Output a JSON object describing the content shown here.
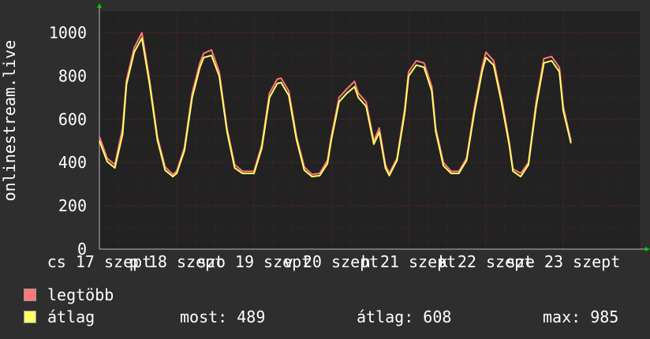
{
  "chart_data": {
    "type": "line",
    "title": "",
    "ylabel": "onlinestream.live",
    "ylim": [
      0,
      1100
    ],
    "yticks": [
      0,
      200,
      400,
      600,
      800,
      1000
    ],
    "xtick_labels": [
      "cs 17 szept",
      "p 18 szept",
      "szo 19 szept",
      "v 20 szept",
      "h 21 szept",
      "k 22 szept",
      "sze 23 szept"
    ],
    "grid": true,
    "colors": {
      "max": "#ff7777",
      "avg": "#ffff66",
      "grid": "#7a2222",
      "axis": "#bbbbbb",
      "arrow": "#00cc00"
    },
    "series": [
      {
        "name": "legtöbb",
        "key": "max",
        "color": "#ff7777"
      },
      {
        "name": "átlag",
        "key": "avg",
        "color": "#ffff66"
      }
    ],
    "x": [
      0,
      0.1,
      0.2,
      0.3,
      0.35,
      0.45,
      0.55,
      0.65,
      0.75,
      0.85,
      0.95,
      1.0,
      1.1,
      1.2,
      1.3,
      1.35,
      1.45,
      1.55,
      1.65,
      1.75,
      1.85,
      1.95,
      2.0,
      2.1,
      2.2,
      2.3,
      2.35,
      2.45,
      2.55,
      2.65,
      2.75,
      2.85,
      2.95,
      3.0,
      3.1,
      3.2,
      3.3,
      3.35,
      3.45,
      3.55,
      3.62,
      3.7,
      3.75,
      3.85,
      3.95,
      4.0,
      4.1,
      4.2,
      4.3,
      4.35,
      4.45,
      4.55,
      4.65,
      4.75,
      4.85,
      4.95,
      5.0,
      5.1,
      5.2,
      5.3,
      5.35,
      5.45,
      5.55,
      5.65,
      5.75,
      5.85,
      5.95,
      6.0,
      6.1,
      6.2,
      6.3,
      6.35,
      6.45,
      6.55,
      6.65,
      6.75,
      6.85,
      6.98
    ],
    "max": [
      520,
      420,
      390,
      560,
      780,
      930,
      1000,
      780,
      520,
      380,
      345,
      360,
      470,
      720,
      860,
      905,
      920,
      820,
      560,
      390,
      360,
      360,
      360,
      480,
      720,
      785,
      790,
      730,
      520,
      380,
      345,
      350,
      410,
      520,
      700,
      740,
      775,
      720,
      680,
      500,
      560,
      390,
      350,
      420,
      650,
      820,
      870,
      860,
      750,
      560,
      400,
      360,
      360,
      420,
      650,
      840,
      910,
      870,
      700,
      500,
      370,
      350,
      400,
      680,
      880,
      890,
      840,
      660,
      500
    ],
    "avg": [
      500,
      405,
      375,
      530,
      760,
      910,
      975,
      760,
      505,
      365,
      335,
      350,
      455,
      700,
      840,
      885,
      895,
      800,
      545,
      375,
      350,
      350,
      350,
      465,
      700,
      765,
      770,
      710,
      505,
      365,
      335,
      340,
      395,
      505,
      680,
      720,
      750,
      700,
      660,
      485,
      540,
      375,
      340,
      410,
      630,
      800,
      850,
      840,
      730,
      545,
      385,
      350,
      350,
      410,
      630,
      820,
      885,
      850,
      680,
      485,
      360,
      335,
      390,
      660,
      860,
      870,
      820,
      640,
      489
    ]
  },
  "legend": [
    {
      "label": "legtöbb",
      "color": "#ff7777"
    },
    {
      "label": "átlag",
      "color": "#ffff66"
    }
  ],
  "stats": {
    "now": "most: 489",
    "avg": "átlag: 608",
    "max": "max: 985"
  }
}
